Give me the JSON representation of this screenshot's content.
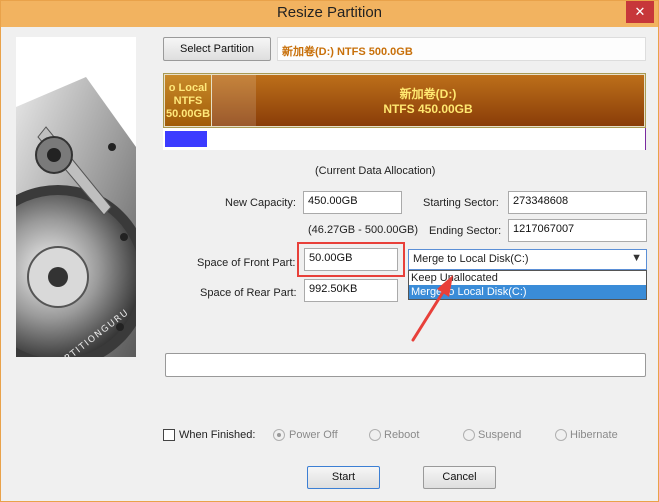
{
  "window": {
    "title": "Resize Partition",
    "close_glyph": "✕"
  },
  "sidebar": {
    "brand": "PARTITIONGURU",
    "icon": "hard-disk-illustration"
  },
  "select_partition": {
    "button_label": "Select Partition",
    "current": "新加卷(D:) NTFS 500.0GB"
  },
  "disk_map": {
    "left_segment": {
      "line1": "o Local",
      "line2": "NTFS",
      "line3": "50.00GB"
    },
    "main_segment": {
      "line1": "新加卷(D:)",
      "line2": "NTFS 450.00GB"
    }
  },
  "allocation_caption": "(Current Data Allocation)",
  "form": {
    "new_capacity_label": "New Capacity:",
    "new_capacity_value": "450.00GB",
    "range_text": "(46.27GB - 500.00GB)",
    "starting_sector_label": "Starting Sector:",
    "starting_sector_value": "273348608",
    "ending_sector_label": "Ending Sector:",
    "ending_sector_value": "1217067007",
    "front_space_label": "Space of Front Part:",
    "front_space_value": "50.00GB",
    "rear_space_label": "Space of Rear Part:",
    "rear_space_value": "992.50KB"
  },
  "front_action": {
    "selected": "Merge to Local Disk(C:)",
    "options": [
      "Keep Unallocated",
      "Merge to Local Disk(C:)"
    ]
  },
  "when_finished": {
    "label": "When Finished:",
    "options": [
      "Power Off",
      "Reboot",
      "Suspend",
      "Hibernate"
    ]
  },
  "buttons": {
    "start": "Start",
    "cancel": "Cancel"
  },
  "colors": {
    "title_bar": "#f2b360",
    "partition_fill": "#a04a0c",
    "annotation": "#e8403a"
  }
}
